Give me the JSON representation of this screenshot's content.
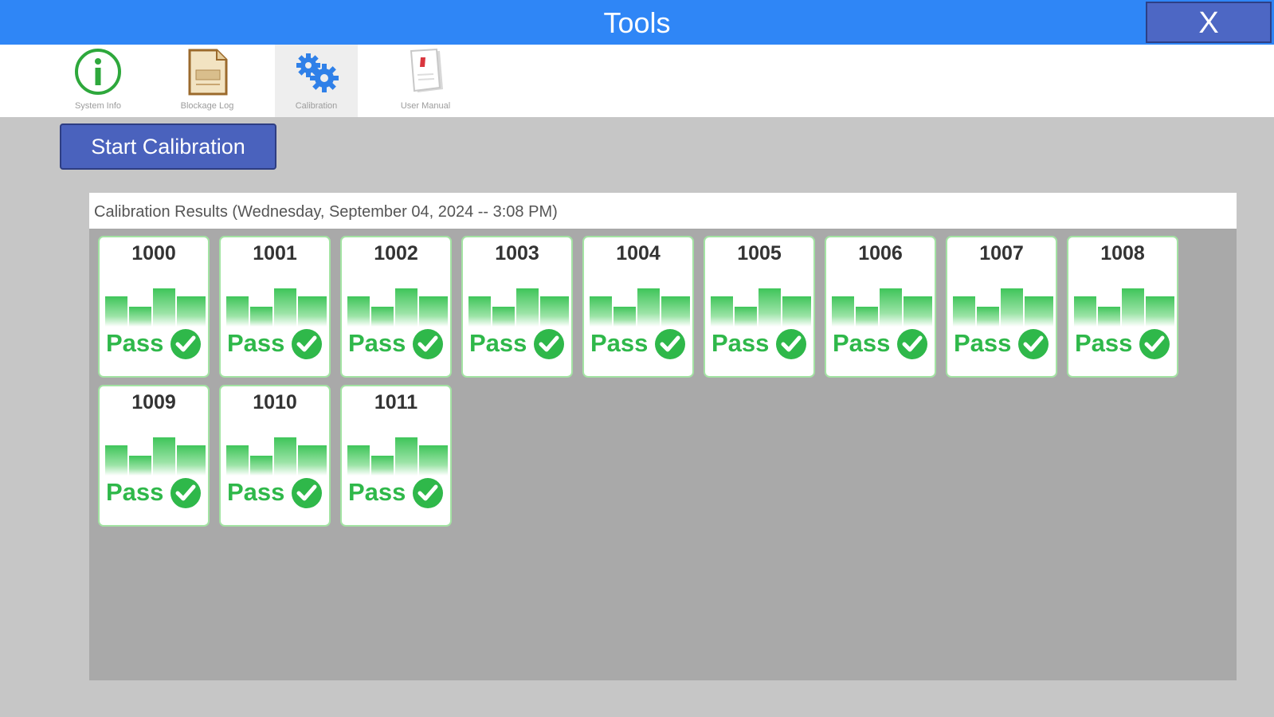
{
  "window": {
    "title": "Tools",
    "close_label": "X"
  },
  "toolbar": {
    "items": [
      {
        "label": "System Info",
        "icon": "info-icon"
      },
      {
        "label": "Blockage Log",
        "icon": "log-document-icon"
      },
      {
        "label": "Calibration",
        "icon": "gears-icon",
        "active": true
      },
      {
        "label": "User Manual",
        "icon": "manual-icon"
      }
    ]
  },
  "start_button": {
    "label": "Start Calibration"
  },
  "results": {
    "header": "Calibration Results (Wednesday, September 04, 2024 -- 3:08 PM)",
    "cards": [
      {
        "id": "1000",
        "status": "Pass"
      },
      {
        "id": "1001",
        "status": "Pass"
      },
      {
        "id": "1002",
        "status": "Pass"
      },
      {
        "id": "1003",
        "status": "Pass"
      },
      {
        "id": "1004",
        "status": "Pass"
      },
      {
        "id": "1005",
        "status": "Pass"
      },
      {
        "id": "1006",
        "status": "Pass"
      },
      {
        "id": "1007",
        "status": "Pass"
      },
      {
        "id": "1008",
        "status": "Pass"
      },
      {
        "id": "1009",
        "status": "Pass"
      },
      {
        "id": "1010",
        "status": "Pass"
      },
      {
        "id": "1011",
        "status": "Pass"
      }
    ]
  },
  "colors": {
    "titlebar": "#2f86f6",
    "button": "#4a62bd",
    "pass_green": "#2fb84a"
  }
}
